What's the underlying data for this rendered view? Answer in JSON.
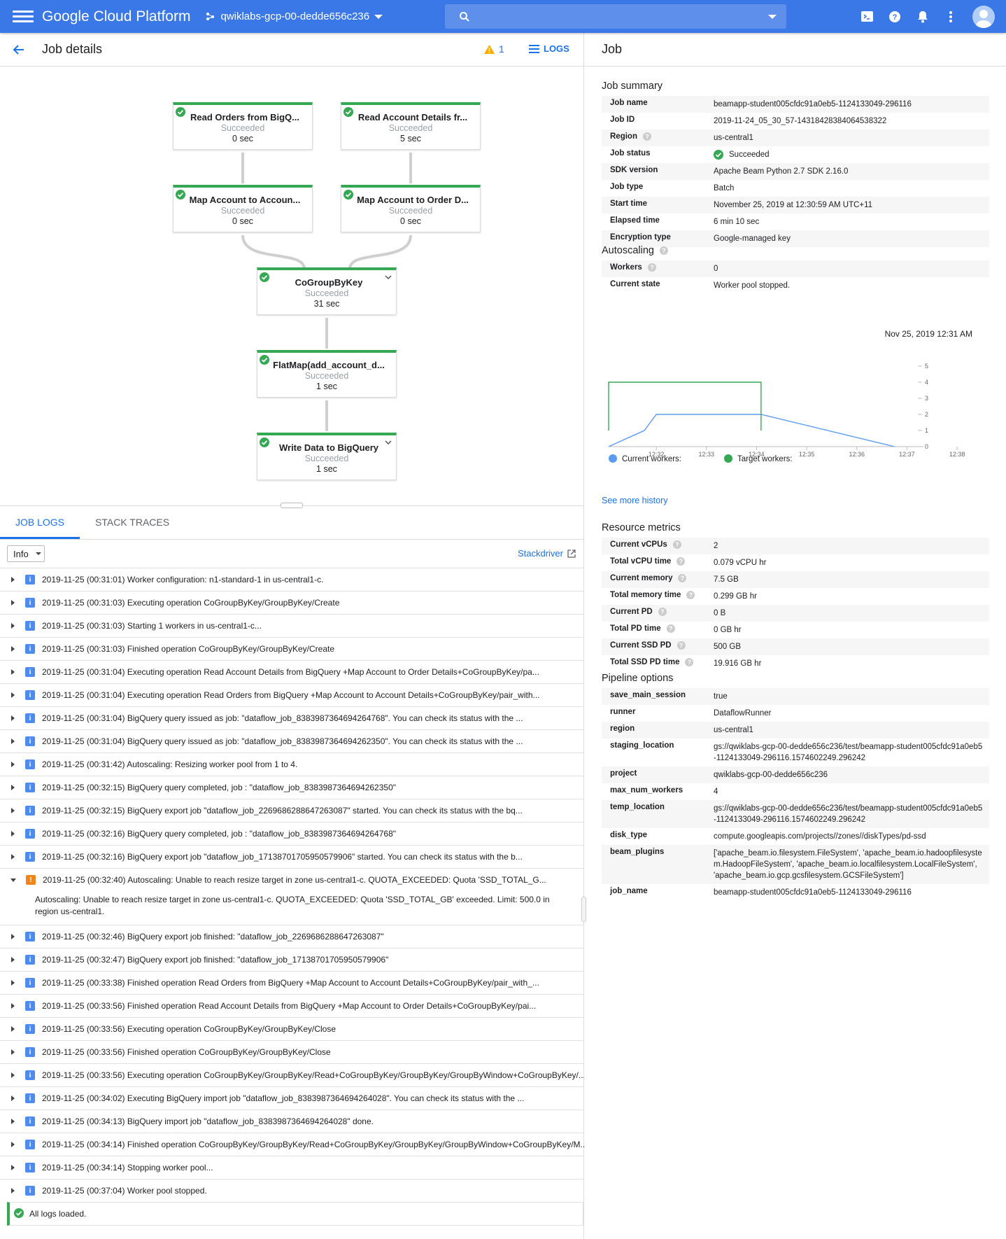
{
  "topbar": {
    "brand": "Google Cloud Platform",
    "project": "qwiklabs-gcp-00-dedde656c236"
  },
  "left": {
    "title": "Job details",
    "warning_count": "1",
    "logs_label": "LOGS"
  },
  "graph": {
    "nodes": [
      {
        "title": "Read Orders from BigQ...",
        "status": "Succeeded",
        "duration": "0 sec"
      },
      {
        "title": "Read Account Details fr...",
        "status": "Succeeded",
        "duration": "5 sec"
      },
      {
        "title": "Map Account to Accoun...",
        "status": "Succeeded",
        "duration": "0 sec"
      },
      {
        "title": "Map Account to Order D...",
        "status": "Succeeded",
        "duration": "0 sec"
      },
      {
        "title": "CoGroupByKey",
        "status": "Succeeded",
        "duration": "31 sec"
      },
      {
        "title": "FlatMap(add_account_d...",
        "status": "Succeeded",
        "duration": "1 sec"
      },
      {
        "title": "Write Data to BigQuery",
        "status": "Succeeded",
        "duration": "1 sec"
      }
    ]
  },
  "tabs": {
    "job_logs": "JOB LOGS",
    "stack_traces": "STACK TRACES"
  },
  "filter": {
    "level": "Info",
    "stackdriver": "Stackdriver"
  },
  "logs": [
    {
      "sev": "info",
      "text": "2019-11-25 (00:31:01) Worker configuration: n1-standard-1 in us-central1-c."
    },
    {
      "sev": "info",
      "text": "2019-11-25 (00:31:03) Executing operation CoGroupByKey/GroupByKey/Create"
    },
    {
      "sev": "info",
      "text": "2019-11-25 (00:31:03) Starting 1 workers in us-central1-c..."
    },
    {
      "sev": "info",
      "text": "2019-11-25 (00:31:03) Finished operation CoGroupByKey/GroupByKey/Create"
    },
    {
      "sev": "info",
      "text": "2019-11-25 (00:31:04) Executing operation Read Account Details from BigQuery +Map Account to Order Details+CoGroupByKey/pa..."
    },
    {
      "sev": "info",
      "text": "2019-11-25 (00:31:04) Executing operation Read Orders from BigQuery +Map Account to Account Details+CoGroupByKey/pair_with..."
    },
    {
      "sev": "info",
      "text": "2019-11-25 (00:31:04) BigQuery query issued as job: \"dataflow_job_8383987364694264768\". You can check its status with the ..."
    },
    {
      "sev": "info",
      "text": "2019-11-25 (00:31:04) BigQuery query issued as job: \"dataflow_job_8383987364694262350\". You can check its status with the ..."
    },
    {
      "sev": "info",
      "text": "2019-11-25 (00:31:42) Autoscaling: Resizing worker pool from 1 to 4."
    },
    {
      "sev": "info",
      "text": "2019-11-25 (00:32:15) BigQuery query completed, job : \"dataflow_job_8383987364694262350\""
    },
    {
      "sev": "info",
      "text": "2019-11-25 (00:32:15) BigQuery export job \"dataflow_job_2269686288647263087\" started. You can check its status with the bq..."
    },
    {
      "sev": "info",
      "text": "2019-11-25 (00:32:16) BigQuery query completed, job : \"dataflow_job_8383987364694264768\""
    },
    {
      "sev": "info",
      "text": "2019-11-25 (00:32:16) BigQuery export job \"dataflow_job_17138701705950579906\" started. You can check its status with the b..."
    },
    {
      "sev": "warn",
      "text": "2019-11-25 (00:32:40) Autoscaling: Unable to reach resize target in zone us-central1-c. QUOTA_EXCEEDED: Quota 'SSD_TOTAL_G...",
      "expanded": true,
      "detail": "Autoscaling: Unable to reach resize target in zone us-central1-c. QUOTA_EXCEEDED: Quota 'SSD_TOTAL_GB' exceeded.  Limit: 500.0 in region us-central1."
    },
    {
      "sev": "info",
      "text": "2019-11-25 (00:32:46) BigQuery export job finished: \"dataflow_job_2269686288647263087\""
    },
    {
      "sev": "info",
      "text": "2019-11-25 (00:32:47) BigQuery export job finished: \"dataflow_job_17138701705950579906\""
    },
    {
      "sev": "info",
      "text": "2019-11-25 (00:33:38) Finished operation Read Orders from BigQuery +Map Account to Account Details+CoGroupByKey/pair_with_..."
    },
    {
      "sev": "info",
      "text": "2019-11-25 (00:33:56) Finished operation Read Account Details from BigQuery +Map Account to Order Details+CoGroupByKey/pai..."
    },
    {
      "sev": "info",
      "text": "2019-11-25 (00:33:56) Executing operation CoGroupByKey/GroupByKey/Close"
    },
    {
      "sev": "info",
      "text": "2019-11-25 (00:33:56) Finished operation CoGroupByKey/GroupByKey/Close"
    },
    {
      "sev": "info",
      "text": "2019-11-25 (00:33:56) Executing operation CoGroupByKey/GroupByKey/Read+CoGroupByKey/GroupByKey/GroupByWindow+CoGroupByKey/..."
    },
    {
      "sev": "info",
      "text": "2019-11-25 (00:34:02) Executing BigQuery import job \"dataflow_job_8383987364694264028\". You can check its status with the ..."
    },
    {
      "sev": "info",
      "text": "2019-11-25 (00:34:13) BigQuery import job \"dataflow_job_8383987364694264028\" done."
    },
    {
      "sev": "info",
      "text": "2019-11-25 (00:34:14) Finished operation CoGroupByKey/GroupByKey/Read+CoGroupByKey/GroupByKey/GroupByWindow+CoGroupByKey/M..."
    },
    {
      "sev": "info",
      "text": "2019-11-25 (00:34:14) Stopping worker pool..."
    },
    {
      "sev": "info",
      "text": "2019-11-25 (00:37:04) Worker pool stopped."
    }
  ],
  "all_loaded": "All logs loaded.",
  "right": {
    "title": "Job",
    "job_summary_title": "Job summary",
    "job_summary": [
      {
        "k": "Job name",
        "v": "beamapp-student005cfdc91a0eb5-1124133049-296116"
      },
      {
        "k": "Job ID",
        "v": "2019-11-24_05_30_57-14318428384064538322"
      },
      {
        "k": "Region",
        "v": "us-central1",
        "help": true
      },
      {
        "k": "Job status",
        "v": "Succeeded",
        "ok": true
      },
      {
        "k": "SDK version",
        "v": "Apache Beam Python 2.7 SDK 2.16.0"
      },
      {
        "k": "Job type",
        "v": "Batch"
      },
      {
        "k": "Start time",
        "v": "November 25, 2019 at 12:30:59 AM UTC+11"
      },
      {
        "k": "Elapsed time",
        "v": "6 min 10 sec"
      },
      {
        "k": "Encryption type",
        "v": "Google-managed key"
      }
    ],
    "autoscaling_title": "Autoscaling",
    "autoscaling": [
      {
        "k": "Workers",
        "v": "0",
        "help": true
      },
      {
        "k": "Current state",
        "v": "Worker pool stopped."
      }
    ],
    "chart_timestamp": "Nov 25, 2019 12:31 AM",
    "see_more": "See more history",
    "resource_title": "Resource metrics",
    "resources": [
      {
        "k": "Current vCPUs",
        "v": "2",
        "help": true
      },
      {
        "k": "Total vCPU time",
        "v": "0.079 vCPU hr",
        "help": true
      },
      {
        "k": "Current memory",
        "v": "7.5 GB",
        "help": true
      },
      {
        "k": "Total memory time",
        "v": "0.299 GB hr",
        "help": true
      },
      {
        "k": "Current PD",
        "v": "0 B",
        "help": true
      },
      {
        "k": "Total PD time",
        "v": "0 GB hr",
        "help": true
      },
      {
        "k": "Current SSD PD",
        "v": "500 GB",
        "help": true
      },
      {
        "k": "Total SSD PD time",
        "v": "19.916 GB hr",
        "help": true
      }
    ],
    "pipeline_title": "Pipeline options",
    "pipeline": [
      {
        "k": "save_main_session",
        "v": "true"
      },
      {
        "k": "runner",
        "v": "DataflowRunner"
      },
      {
        "k": "region",
        "v": "us-central1"
      },
      {
        "k": "staging_location",
        "v": "gs://qwiklabs-gcp-00-dedde656c236/test/beamapp-student005cfdc91a0eb5-1124133049-296116.1574602249.296242"
      },
      {
        "k": "project",
        "v": "qwiklabs-gcp-00-dedde656c236"
      },
      {
        "k": "max_num_workers",
        "v": "4"
      },
      {
        "k": "temp_location",
        "v": "gs://qwiklabs-gcp-00-dedde656c236/test/beamapp-student005cfdc91a0eb5-1124133049-296116.1574602249.296242"
      },
      {
        "k": "disk_type",
        "v": "compute.googleapis.com/projects//zones//diskTypes/pd-ssd"
      },
      {
        "k": "beam_plugins",
        "v": "['apache_beam.io.filesystem.FileSystem', 'apache_beam.io.hadoopfilesystem.HadoopFileSystem', 'apache_beam.io.localfilesystem.LocalFileSystem', 'apache_beam.io.gcp.gcsfilesystem.GCSFileSystem']"
      },
      {
        "k": "job_name",
        "v": "beamapp-student005cfdc91a0eb5-1124133049-296116"
      }
    ]
  },
  "chart_data": {
    "type": "line",
    "x": [
      "12:32",
      "12:33",
      "12:34",
      "12:35",
      "12:36",
      "12:37",
      "12:38"
    ],
    "ylim": [
      0,
      5
    ],
    "yticks": [
      "0",
      "1",
      "2",
      "3",
      "4",
      "5"
    ],
    "series": [
      {
        "name": "Current workers:",
        "color": "#5b9cf0",
        "points": [
          [
            0,
            0
          ],
          [
            0.75,
            1
          ],
          [
            1.0,
            2
          ],
          [
            3.2,
            2
          ],
          [
            6.0,
            0
          ]
        ]
      },
      {
        "name": "Target workers:",
        "color": "#34a853",
        "points": [
          [
            0,
            1
          ],
          [
            0,
            4
          ],
          [
            3.2,
            4
          ],
          [
            3.2,
            1
          ]
        ]
      }
    ]
  }
}
